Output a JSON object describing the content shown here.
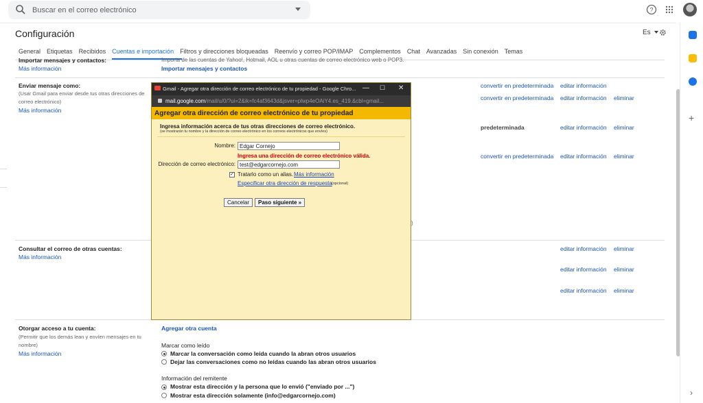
{
  "search": {
    "placeholder": "Buscar en el correo electrónico"
  },
  "header": {
    "title": "Configuración",
    "language": "Es"
  },
  "tabs": [
    {
      "label": "General"
    },
    {
      "label": "Etiquetas"
    },
    {
      "label": "Recibidos"
    },
    {
      "label": "Cuentas e importación",
      "active": true
    },
    {
      "label": "Filtros y direcciones bloqueadas"
    },
    {
      "label": "Reenvío y correo POP/IMAP"
    },
    {
      "label": "Complementos"
    },
    {
      "label": "Chat"
    },
    {
      "label": "Avanzadas"
    },
    {
      "label": "Sin conexión"
    },
    {
      "label": "Temas"
    }
  ],
  "import_section": {
    "label": "Importar mensajes y contactos:",
    "more_info": "Más información",
    "description": "Importa de las cuentas de Yahoo!, Hotmail, AOL u otras cuentas de correo electrónico web o POP3.",
    "action": "Importar mensajes y contactos"
  },
  "send_as_section": {
    "label": "Enviar mensaje como:",
    "sub": "(Usar Gmail para enviar desde tus otras direcciones de correo electrónico)",
    "more_info": "Más información",
    "rows": [
      {
        "left": "convertir en predeterminada",
        "edit": "editar información",
        "delete": ""
      },
      {
        "left": "convertir en predeterminada",
        "edit": "editar información",
        "delete": "eliminar"
      },
      {
        "left": "predeterminada",
        "edit": "editar información",
        "delete": "eliminar"
      },
      {
        "left": "convertir en predeterminada",
        "edit": "editar información",
        "delete": "eliminar"
      }
    ],
    "trailing_fragment": ")"
  },
  "check_mail_section": {
    "label": "Consultar el correo de otras cuentas:",
    "more_info": "Más información",
    "rows": [
      {
        "edit": "editar información",
        "delete": "eliminar"
      },
      {
        "edit": "editar información",
        "delete": "eliminar"
      },
      {
        "edit": "editar información",
        "delete": "eliminar"
      }
    ]
  },
  "grant_access_section": {
    "label": "Otorgar acceso a tu cuenta:",
    "sub": "(Permitir que los demás lean y envíen mensajes en tu nombre)",
    "more_info": "Más información",
    "add_account": "Agregar otra cuenta",
    "mark_read_title": "Marcar como leído",
    "mark_read_options": [
      {
        "label": "Marcar la conversación como leída cuando la abran otros usuarios",
        "selected": true
      },
      {
        "label": "Dejar las conversaciones como no leídas cuando las abran otros usuarios",
        "selected": false
      }
    ],
    "sender_info_title": "Información del remitente",
    "sender_info_options": [
      {
        "label": "Mostrar esta dirección y la persona que lo envió (\"enviado por ...\")",
        "selected": true
      },
      {
        "label": "Mostrar esta dirección solamente (info@edgarcornejo.com)",
        "selected": false
      }
    ]
  },
  "popup": {
    "window_title": "Gmail - Agregar otra dirección de correo electrónico de tu propiedad - Google Chro...",
    "url_host": "mail.google.com",
    "url_rest": "/mail/u/0/?ui=2&ik=fc4af3643d&jsver=plwp4eOAiY4.es_419.&cbl=gmail...",
    "heading": "Agregar otra dirección de correo electrónico de tu propiedad",
    "intro": "Ingresa información acerca de tus otras direcciones de correo electrónico.",
    "intro_sub": "(se mostrarán tu nombre y la dirección de correo electrónico en los correos electrónicos que envíes)",
    "name_label": "Nombre:",
    "name_value": "Edgar Cornejo",
    "error": "Ingresa una dirección de correo electrónico válida.",
    "email_label": "Dirección de correo electrónico:",
    "email_value": "test@edgarcornejo.com",
    "alias_label": "Tratarlo como un alias.",
    "alias_more": "Más información",
    "reply_link": "Especificar otra dirección de respuesta",
    "optional": "(opcional)",
    "cancel": "Cancelar",
    "next": "Paso siguiente »"
  },
  "colors": {
    "accent": "#1a73e8",
    "link": "#1a55b8",
    "popup_bg": "#fbf0be",
    "popup_header": "#f5b800",
    "error": "#cc0000"
  }
}
